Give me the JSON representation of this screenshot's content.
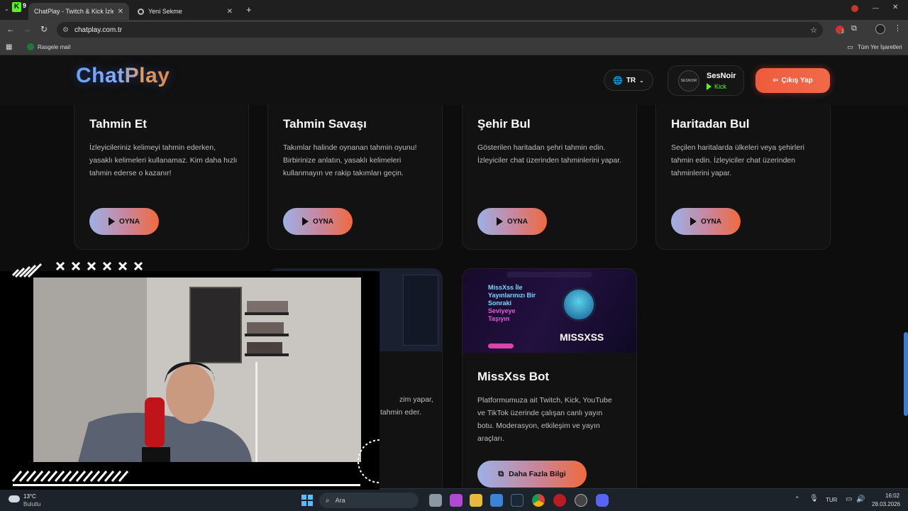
{
  "browser": {
    "tabs": [
      {
        "title": "ChatPlay - Twitch & Kick İzleyici",
        "active": true
      },
      {
        "title": "Yeni Sekme",
        "active": false
      }
    ],
    "tab_badge": "9",
    "url": "chatplay.com.tr",
    "bookmark": "Rasgele mail",
    "all_bookmarks": "Tüm Yer İşaretleri",
    "extension_badge": "2"
  },
  "header": {
    "logo": "ChatPlay",
    "lang": "TR",
    "user": {
      "name": "SesNoir",
      "platform": "Kick",
      "avatar_text": "SESNOIR"
    },
    "logout": "Çıkış Yap"
  },
  "cards": [
    {
      "title": "Tahmin Et",
      "desc": "İzleyicileriniz kelimeyi tahmin ederken, yasaklı kelimeleri kullanamaz. Kim daha hızlı tahmin ederse o kazanır!",
      "button": "OYNA"
    },
    {
      "title": "Tahmin Savaşı",
      "desc": "Takımlar halinde oynanan tahmin oyunu! Birbirinize anlatın, yasaklı kelimeleri kullanmayın ve rakip takımları geçin.",
      "button": "OYNA"
    },
    {
      "title": "Şehir Bul",
      "desc": "Gösterilen haritadan şehri tahmin edin. İzleyiciler chat üzerinden tahminlerini yapar.",
      "button": "OYNA"
    },
    {
      "title": "Haritadan Bul",
      "desc": "Seçilen haritalarda ülkeleri veya şehirleri tahmin edin. İzleyiciler chat üzerinden tahminlerini yapar.",
      "button": "OYNA"
    }
  ],
  "hidden_card_partial": {
    "line1": "zim yapar,",
    "line2": "tahmin eder."
  },
  "bot_card": {
    "thumb_headline": [
      "MissXss İle",
      "Yayınlarınızı Bir",
      "Sonraki",
      "Seviyeye",
      "Taşıyın"
    ],
    "thumb_brand": "MISSXSS",
    "title": "MissXss Bot",
    "desc": "Platformumuza ait Twitch, Kick, YouTube ve TikTok üzerinde çalışan canlı yayın botu. Moderasyon, etkileşim ve yayın araçları.",
    "button": "Daha Fazla Bilgi"
  },
  "taskbar": {
    "weather_temp": "13°C",
    "weather_desc": "Bulutlu",
    "search": "Ara",
    "lang": "TUR",
    "time": "16:02",
    "date": "28.03.2026"
  },
  "colors": {
    "accent_orange": "#f06a3c",
    "accent_blue": "#6aa7ff",
    "kick_green": "#53fc18"
  }
}
